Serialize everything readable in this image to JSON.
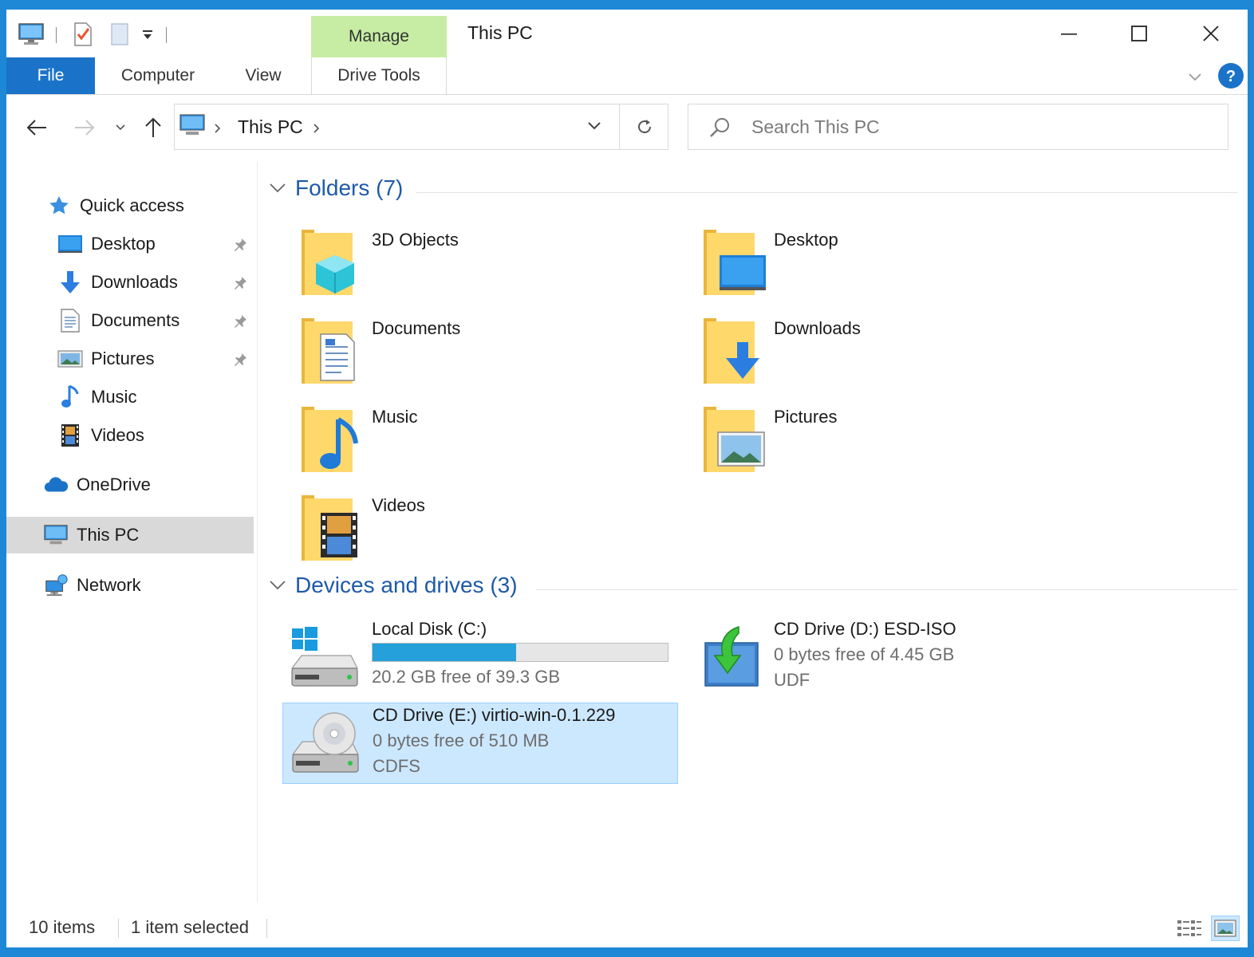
{
  "window": {
    "title": "This PC",
    "context_tab_group": "Manage"
  },
  "quick_access_toolbar": {
    "icons": [
      "computer-icon",
      "properties-check-icon",
      "new-folder-icon",
      "customize-dropdown-icon"
    ]
  },
  "ribbon": {
    "tabs": [
      {
        "label": "File"
      },
      {
        "label": "Computer"
      },
      {
        "label": "View"
      },
      {
        "label": "Drive Tools"
      }
    ]
  },
  "navigation": {
    "address_path": "This PC",
    "search_placeholder": "Search This PC"
  },
  "sidebar": {
    "quick_access_label": "Quick access",
    "items": [
      {
        "label": "Desktop",
        "pinned": true
      },
      {
        "label": "Downloads",
        "pinned": true
      },
      {
        "label": "Documents",
        "pinned": true
      },
      {
        "label": "Pictures",
        "pinned": true
      },
      {
        "label": "Music",
        "pinned": false
      },
      {
        "label": "Videos",
        "pinned": false
      }
    ],
    "onedrive_label": "OneDrive",
    "thispc_label": "This PC",
    "network_label": "Network"
  },
  "folders_group": {
    "header": "Folders (7)",
    "items": [
      {
        "name": "3D Objects"
      },
      {
        "name": "Desktop"
      },
      {
        "name": "Documents"
      },
      {
        "name": "Downloads"
      },
      {
        "name": "Music"
      },
      {
        "name": "Pictures"
      },
      {
        "name": "Videos"
      }
    ]
  },
  "drives_group": {
    "header": "Devices and drives (3)",
    "items": [
      {
        "name": "Local Disk (C:)",
        "free_text": "20.2 GB free of 39.3 GB",
        "used_fraction": 0.486
      },
      {
        "name": "CD Drive (D:) ESD-ISO",
        "free_text": "0 bytes free of 4.45 GB",
        "fs": "UDF"
      },
      {
        "name": "CD Drive (E:) virtio-win-0.1.229",
        "free_text": "0 bytes free of 510 MB",
        "fs": "CDFS",
        "selected": true
      }
    ]
  },
  "status_bar": {
    "item_count": "10 items",
    "selection": "1 item selected"
  },
  "colors": {
    "accent": "#1a73c8",
    "context_tab": "#c6eda3",
    "selection": "#cce8ff",
    "progress_fill": "#26a0da",
    "group_header": "#1e5aa8"
  }
}
